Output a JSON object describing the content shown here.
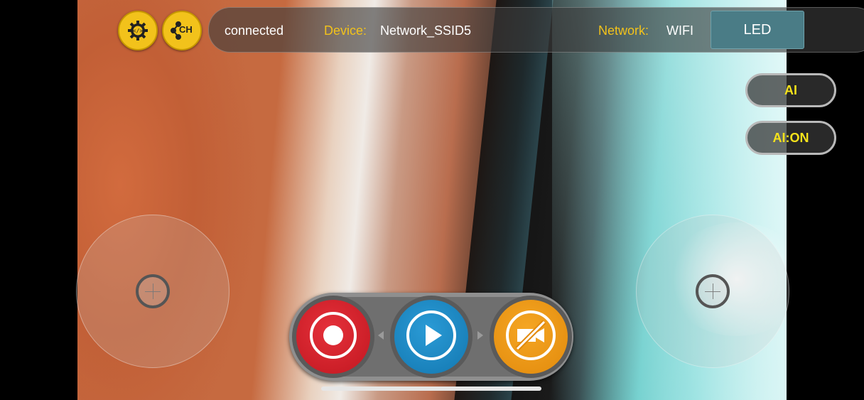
{
  "toolbar": {
    "settings_icon": "gear-code-icon",
    "channel_icon": "network-ch-icon",
    "channel_label": "CH"
  },
  "status": {
    "connection": "connected",
    "device_label": "Device:",
    "device_value": "Network_SSID5",
    "network_label": "Network:",
    "network_value": "WIFI",
    "led_label": "LED"
  },
  "ai": {
    "ai_label": "AI",
    "ai_toggle_label": "AI:ON"
  },
  "controls": {
    "record_icon": "record-icon",
    "play_icon": "play-icon",
    "camera_off_icon": "camera-off-icon"
  },
  "colors": {
    "accent_yellow": "#f2c21b",
    "record_red": "#c11720",
    "play_blue": "#1377b0",
    "camera_orange": "#e28a0c",
    "led_button": "#4a7c86"
  }
}
